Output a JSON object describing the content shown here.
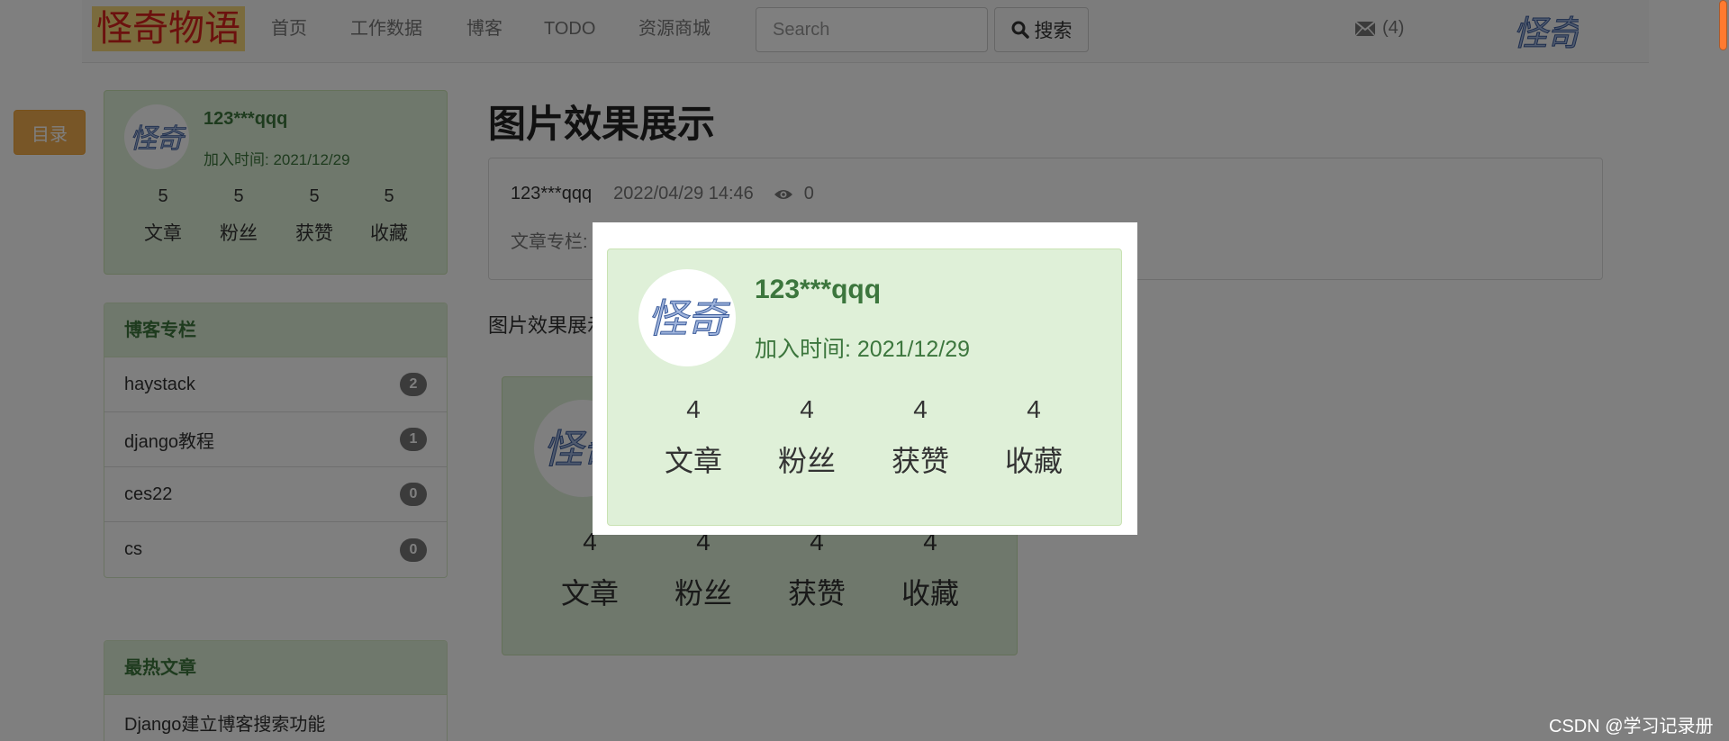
{
  "navbar": {
    "brand": "怪奇物语",
    "links": [
      "首页",
      "工作数据",
      "博客",
      "TODO",
      "资源商城"
    ],
    "search_placeholder": "Search",
    "search_button": "搜索",
    "mail_count": "(4)",
    "logo_text": "怪奇"
  },
  "toc_button": "目录",
  "profile": {
    "avatar_text": "怪奇",
    "name": "123***qqq",
    "join": "加入时间: 2021/12/29",
    "stats": [
      {
        "num": "5",
        "label": "文章"
      },
      {
        "num": "5",
        "label": "粉丝"
      },
      {
        "num": "5",
        "label": "获赞"
      },
      {
        "num": "5",
        "label": "收藏"
      }
    ]
  },
  "blog_columns": {
    "title": "博客专栏",
    "items": [
      {
        "label": "haystack",
        "count": "2"
      },
      {
        "label": "django教程",
        "count": "1"
      },
      {
        "label": "ces22",
        "count": "0"
      },
      {
        "label": "cs",
        "count": "0"
      }
    ]
  },
  "hot_articles": {
    "title": "最热文章",
    "items": [
      "Django建立博客搜索功能"
    ]
  },
  "article": {
    "title": "图片效果展示",
    "author": "123***qqq",
    "time": "2022/04/29 14:46",
    "views": "0",
    "column_label": "文章专栏:",
    "intro": "图片效果展示"
  },
  "demo_card": {
    "avatar_text": "怪奇",
    "stats": [
      {
        "num": "4",
        "label": "文章"
      },
      {
        "num": "4",
        "label": "粉丝"
      },
      {
        "num": "4",
        "label": "获赞"
      },
      {
        "num": "4",
        "label": "收藏"
      }
    ]
  },
  "modal": {
    "avatar_text": "怪奇",
    "name": "123***qqq",
    "join": "加入时间: 2021/12/29",
    "stats": [
      {
        "num": "4",
        "label": "文章"
      },
      {
        "num": "4",
        "label": "粉丝"
      },
      {
        "num": "4",
        "label": "获赞"
      },
      {
        "num": "4",
        "label": "收藏"
      }
    ]
  },
  "watermark": "CSDN @学习记录册",
  "colors": {
    "brand_bg": "#f5d67a",
    "brand_text": "#d9221c",
    "success_bg": "#dff0d8",
    "success_text": "#3c763d",
    "warning_btn": "#f0ad4e",
    "badge": "#777777"
  }
}
